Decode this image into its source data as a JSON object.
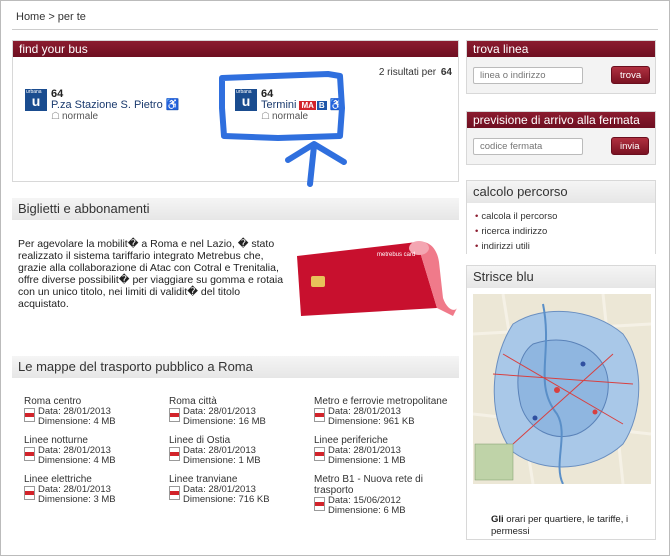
{
  "breadcrumb": {
    "home": "Home",
    "separator": ">",
    "current": "per te"
  },
  "find_bus": {
    "title": "find your bus",
    "results_text": "2 risultati per",
    "results_query": "64",
    "items": [
      {
        "badge": "u",
        "badge_small": "urbana",
        "number": "64",
        "stop": "P.za Stazione S. Pietro",
        "type": "normale"
      },
      {
        "badge": "u",
        "badge_small": "urbana",
        "number": "64",
        "stop": "Termini",
        "metro": [
          "M",
          "A",
          "B"
        ],
        "type": "normale"
      }
    ]
  },
  "tickets": {
    "title": "Biglietti e abbonamenti",
    "description": "Per agevolare la mobilit� a Roma e nel Lazio, � stato realizzato il sistema tariffario integrato Metrebus che, grazie alla collaborazione di Atac con Cotral e Trenitalia, offre diverse possibilit� per viaggiare su gomma e rotaia con un unico titolo, nei limiti di validit� del titolo acquistato.",
    "card_label": "metrebus card"
  },
  "maps": {
    "title": "Le mappe del trasporto pubblico a Roma",
    "items": [
      {
        "title": "Roma centro",
        "date": "Data: 28/01/2013",
        "size": "Dimensione: 4 MB"
      },
      {
        "title": "Roma città",
        "date": "Data: 28/01/2013",
        "size": "Dimensione: 16 MB"
      },
      {
        "title": "Metro e ferrovie metropolitane",
        "date": "Data: 28/01/2013",
        "size": "Dimensione: 961 KB"
      },
      {
        "title": "Linee notturne",
        "date": "Data: 28/01/2013",
        "size": "Dimensione: 4 MB"
      },
      {
        "title": "Linee di Ostia",
        "date": "Data: 28/01/2013",
        "size": "Dimensione: 1 MB"
      },
      {
        "title": "Linee periferiche",
        "date": "Data: 28/01/2013",
        "size": "Dimensione: 1 MB"
      },
      {
        "title": "Linee elettriche",
        "date": "Data: 28/01/2013",
        "size": "Dimensione: 3 MB"
      },
      {
        "title": "Linee tranviane",
        "date": "Data: 28/01/2013",
        "size": "Dimensione: 716 KB"
      },
      {
        "title": "Metro B1 - Nuova rete di trasporto",
        "date": "Data: 15/06/2012",
        "size": "Dimensione: 6 MB"
      }
    ]
  },
  "trova_linea": {
    "title": "trova linea",
    "placeholder": "linea o indirizzo",
    "button": "trova"
  },
  "previsione": {
    "title": "previsione di arrivo alla fermata",
    "placeholder": "codice fermata",
    "button": "invia"
  },
  "calcolo": {
    "title": "calcolo percorso",
    "links": [
      "calcola il percorso",
      "ricerca indirizzo",
      "indirizzi utili"
    ]
  },
  "strisce": {
    "title": "Strisce blu",
    "note_bold": "Gli",
    "note_rest": " orari per quartiere, le tariffe, i permessi"
  },
  "colors": {
    "brand": "#7a1222",
    "link_blue": "#1a4c8f",
    "annotation": "#2f6fde"
  }
}
